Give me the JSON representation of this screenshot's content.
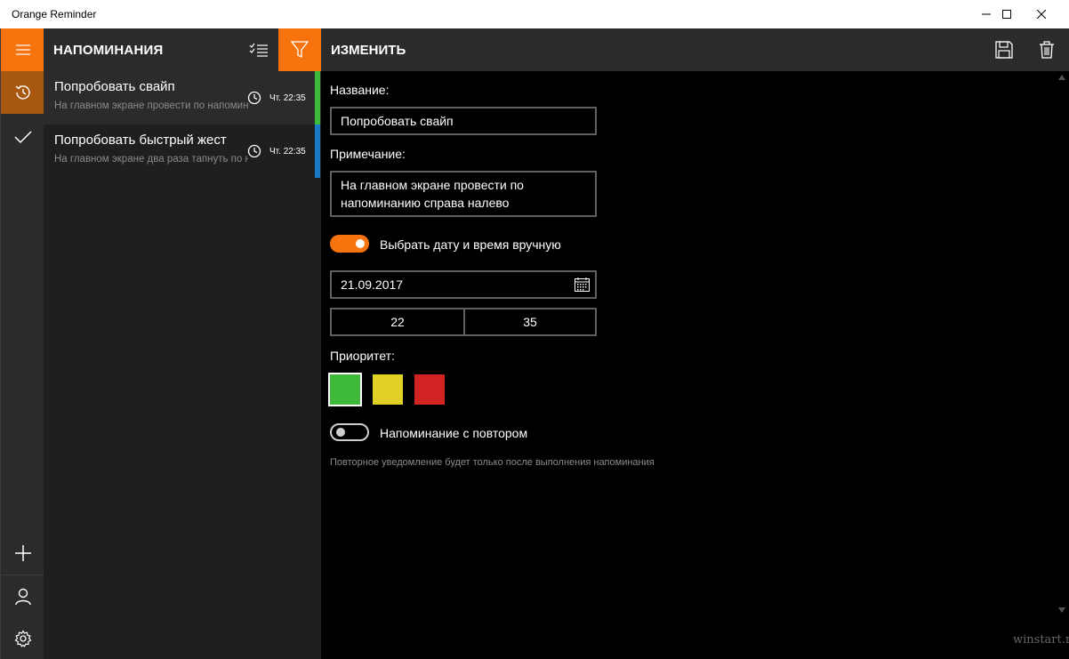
{
  "window": {
    "title": "Orange Reminder",
    "controls": [
      "minimize-icon",
      "maximize-icon",
      "close-icon"
    ]
  },
  "rail": {
    "items": [
      {
        "icon": "hamburger-menu-icon"
      },
      {
        "icon": "history-icon",
        "active": true
      },
      {
        "icon": "checkmark-icon"
      },
      {
        "icon": "plus-icon"
      },
      {
        "icon": "user-icon"
      },
      {
        "icon": "gear-icon"
      }
    ]
  },
  "list": {
    "title": "НАПОМИНАНИЯ",
    "icons": [
      "multi-select-icon",
      "filter-icon"
    ],
    "reminders": [
      {
        "title": "Попробовать свайп",
        "note": "На главном экране провести по напоминанию справа налево",
        "time": "Чт. 22:35",
        "priority_color": "#3fb93a"
      },
      {
        "title": "Попробовать быстрый жест",
        "note": "На главном экране два раза тапнуть по напоминанию",
        "time": "Чт. 22:35",
        "priority_color": "#1a7ac7"
      }
    ]
  },
  "editor": {
    "title": "ИЗМЕНИТЬ",
    "icons": [
      "save-icon",
      "delete-icon"
    ],
    "name_label": "Название:",
    "name_value": "Попробовать свайп",
    "note_label": "Примечание:",
    "note_line1": "На главном экране провести по",
    "note_line2": "напоминанию справа налево",
    "manual_datetime_label": "Выбрать дату и время вручную",
    "manual_datetime_on": true,
    "date_value": "21.09.2017",
    "hour_value": "22",
    "minute_value": "35",
    "priority_label": "Приоритет:",
    "priority_colors": [
      "#3fb93a",
      "#e0cf25",
      "#d22323"
    ],
    "priority_selected": 0,
    "repeat_label": "Напоминание с повтором",
    "repeat_on": false,
    "repeat_hint": "Повторное уведомление будет только после выполнения напоминания"
  },
  "watermark": "winstart.ru",
  "colors": {
    "accent": "#f7730e",
    "accent_dark": "#a8570f",
    "panel": "#2b2b2b",
    "list_bg": "#1f1f1f"
  }
}
